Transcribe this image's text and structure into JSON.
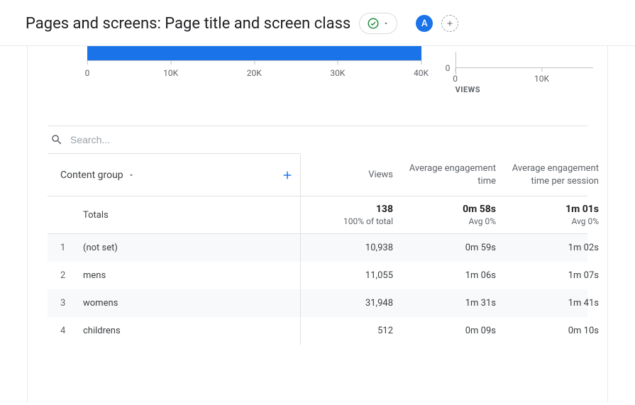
{
  "header": {
    "title": "Pages and screens: Page title and screen class",
    "avatar_letter": "A"
  },
  "chart_data": {
    "type": "bar",
    "title": "",
    "x_ticks": [
      "0",
      "10K",
      "20K",
      "30K",
      "40K"
    ],
    "mini": {
      "zero": "0",
      "ticks": [
        "0",
        "10K"
      ],
      "axis_label": "VIEWS"
    }
  },
  "table": {
    "search_placeholder": "Search...",
    "dimension_label": "Content group",
    "metric_headers": [
      "Views",
      "Average engagement time",
      "Average engagement time per session"
    ],
    "totals": {
      "label": "Totals",
      "cells": [
        {
          "big": "138",
          "small": "100% of total"
        },
        {
          "big": "0m 58s",
          "small": "Avg 0%"
        },
        {
          "big": "1m 01s",
          "small": "Avg 0%"
        }
      ]
    },
    "rows": [
      {
        "idx": "1",
        "name": "(not set)",
        "values": [
          "10,938",
          "0m 59s",
          "1m 02s"
        ]
      },
      {
        "idx": "2",
        "name": "mens",
        "values": [
          "11,055",
          "1m 06s",
          "1m 07s"
        ]
      },
      {
        "idx": "3",
        "name": "womens",
        "values": [
          "31,948",
          "1m 31s",
          "1m 41s"
        ]
      },
      {
        "idx": "4",
        "name": "childrens",
        "values": [
          "512",
          "0m 09s",
          "0m 10s"
        ]
      }
    ]
  }
}
